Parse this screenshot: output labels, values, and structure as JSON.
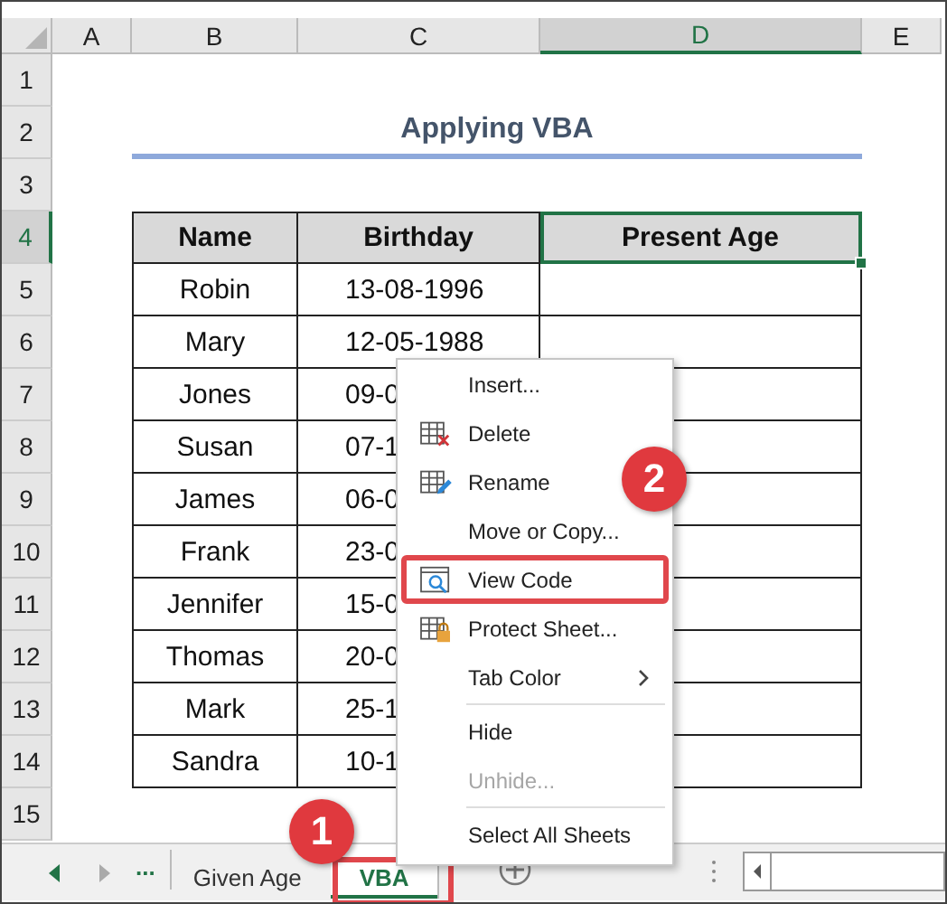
{
  "columns": [
    {
      "label": "A",
      "selected": false
    },
    {
      "label": "B",
      "selected": false
    },
    {
      "label": "C",
      "selected": false
    },
    {
      "label": "D",
      "selected": true
    },
    {
      "label": "E",
      "selected": false
    }
  ],
  "rows": [
    {
      "label": "1",
      "selected": false
    },
    {
      "label": "2",
      "selected": false
    },
    {
      "label": "3",
      "selected": false
    },
    {
      "label": "4",
      "selected": true
    },
    {
      "label": "5",
      "selected": false
    },
    {
      "label": "6",
      "selected": false
    },
    {
      "label": "7",
      "selected": false
    },
    {
      "label": "8",
      "selected": false
    },
    {
      "label": "9",
      "selected": false
    },
    {
      "label": "10",
      "selected": false
    },
    {
      "label": "11",
      "selected": false
    },
    {
      "label": "12",
      "selected": false
    },
    {
      "label": "13",
      "selected": false
    },
    {
      "label": "14",
      "selected": false
    },
    {
      "label": "15",
      "selected": false
    }
  ],
  "title": "Applying VBA",
  "table": {
    "columns": [
      {
        "label": "Name",
        "selected": false
      },
      {
        "label": "Birthday",
        "selected": false
      },
      {
        "label": "Present Age",
        "selected": true
      }
    ],
    "rows": [
      {
        "name": "Robin",
        "birthday": "13-08-1996"
      },
      {
        "name": "Mary",
        "birthday": "12-05-1988"
      },
      {
        "name": "Jones",
        "birthday": "09-0"
      },
      {
        "name": "Susan",
        "birthday": "07-1"
      },
      {
        "name": "James",
        "birthday": "06-0"
      },
      {
        "name": "Frank",
        "birthday": "23-0"
      },
      {
        "name": "Jennifer",
        "birthday": "15-0"
      },
      {
        "name": "Thomas",
        "birthday": "20-0"
      },
      {
        "name": "Mark",
        "birthday": "25-1"
      },
      {
        "name": "Sandra",
        "birthday": "10-1"
      }
    ]
  },
  "context_menu": {
    "items": [
      {
        "kind": "item",
        "label": "Insert...",
        "disabled": false
      },
      {
        "kind": "item",
        "label": "Delete",
        "disabled": false
      },
      {
        "kind": "item",
        "label": "Rename",
        "disabled": false
      },
      {
        "kind": "item",
        "label": "Move or Copy...",
        "disabled": false
      },
      {
        "kind": "item",
        "label": "View Code",
        "disabled": false,
        "highlighted": true,
        "badge": "2"
      },
      {
        "kind": "item",
        "label": "Protect Sheet...",
        "disabled": false
      },
      {
        "kind": "item",
        "label": "Tab Color",
        "disabled": false,
        "submenu": true
      },
      {
        "kind": "separator"
      },
      {
        "kind": "item",
        "label": "Hide",
        "disabled": false
      },
      {
        "kind": "item",
        "label": "Unhide...",
        "disabled": true
      },
      {
        "kind": "separator"
      },
      {
        "kind": "item",
        "label": "Select All Sheets",
        "disabled": false
      }
    ]
  },
  "sheet_tabs": {
    "more": "...",
    "tabs": [
      {
        "label": "Given Age",
        "selected": false
      },
      {
        "label": "VBA",
        "selected": true,
        "highlighted": true,
        "badge": "1"
      }
    ]
  }
}
